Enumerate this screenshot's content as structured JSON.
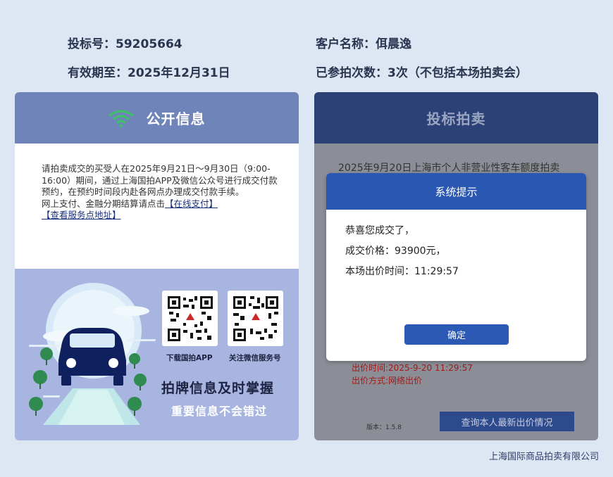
{
  "top_info": {
    "bid_number": "投标号：59205664",
    "valid_until": "有效期至：2025年12月31日",
    "customer_name": "客户名称：佴晨逸",
    "auction_count": "已参拍次数：3次（不包括本场拍卖会）"
  },
  "left_panel": {
    "title": "公开信息",
    "icon": "wifi-icon",
    "notice_text": "请拍卖成交的买受人在2025年9月21日～9月30日（9:00-16:00）期间，通过上海国拍APP及微信公众号进行成交付款预约，在预约时间段内赴各网点办理成交付款手续。",
    "payment_text": "网上支付、金融分期结算请点击",
    "online_pay_link": "【在线支付】",
    "service_link": "【查看服务点地址】",
    "qr_app_caption": "下载国拍APP",
    "qr_wechat_caption": "关注微信服务号",
    "slogan_main": "拍牌信息及时掌握",
    "slogan_sub": "重要信息不会错过"
  },
  "right_panel": {
    "title": "投标拍卖",
    "bg_heading": "2025年9月20日上海市个人非营业性客车额度拍卖",
    "bid_time_line": "出价时间:2025-9-20 11:29:57",
    "bid_method_line": "出价方式:网络出价",
    "version": "版本：1.5.8",
    "query_button": "查询本人最新出价情况"
  },
  "dialog": {
    "title": "系统提示",
    "line1": "恭喜您成交了，",
    "line2": "成交价格：93900元，",
    "line3": "本场出价时间：11:29:57",
    "confirm": "确定"
  },
  "footer": {
    "company": "上海国际商品拍卖有限公司"
  },
  "colors": {
    "page_bg": "#dde6f3",
    "left_header": "#6f84b8",
    "right_header": "#2c4276",
    "dialog_header": "#2957b2",
    "wifi_green": "#3fbf6a",
    "red_text": "#a41818"
  }
}
